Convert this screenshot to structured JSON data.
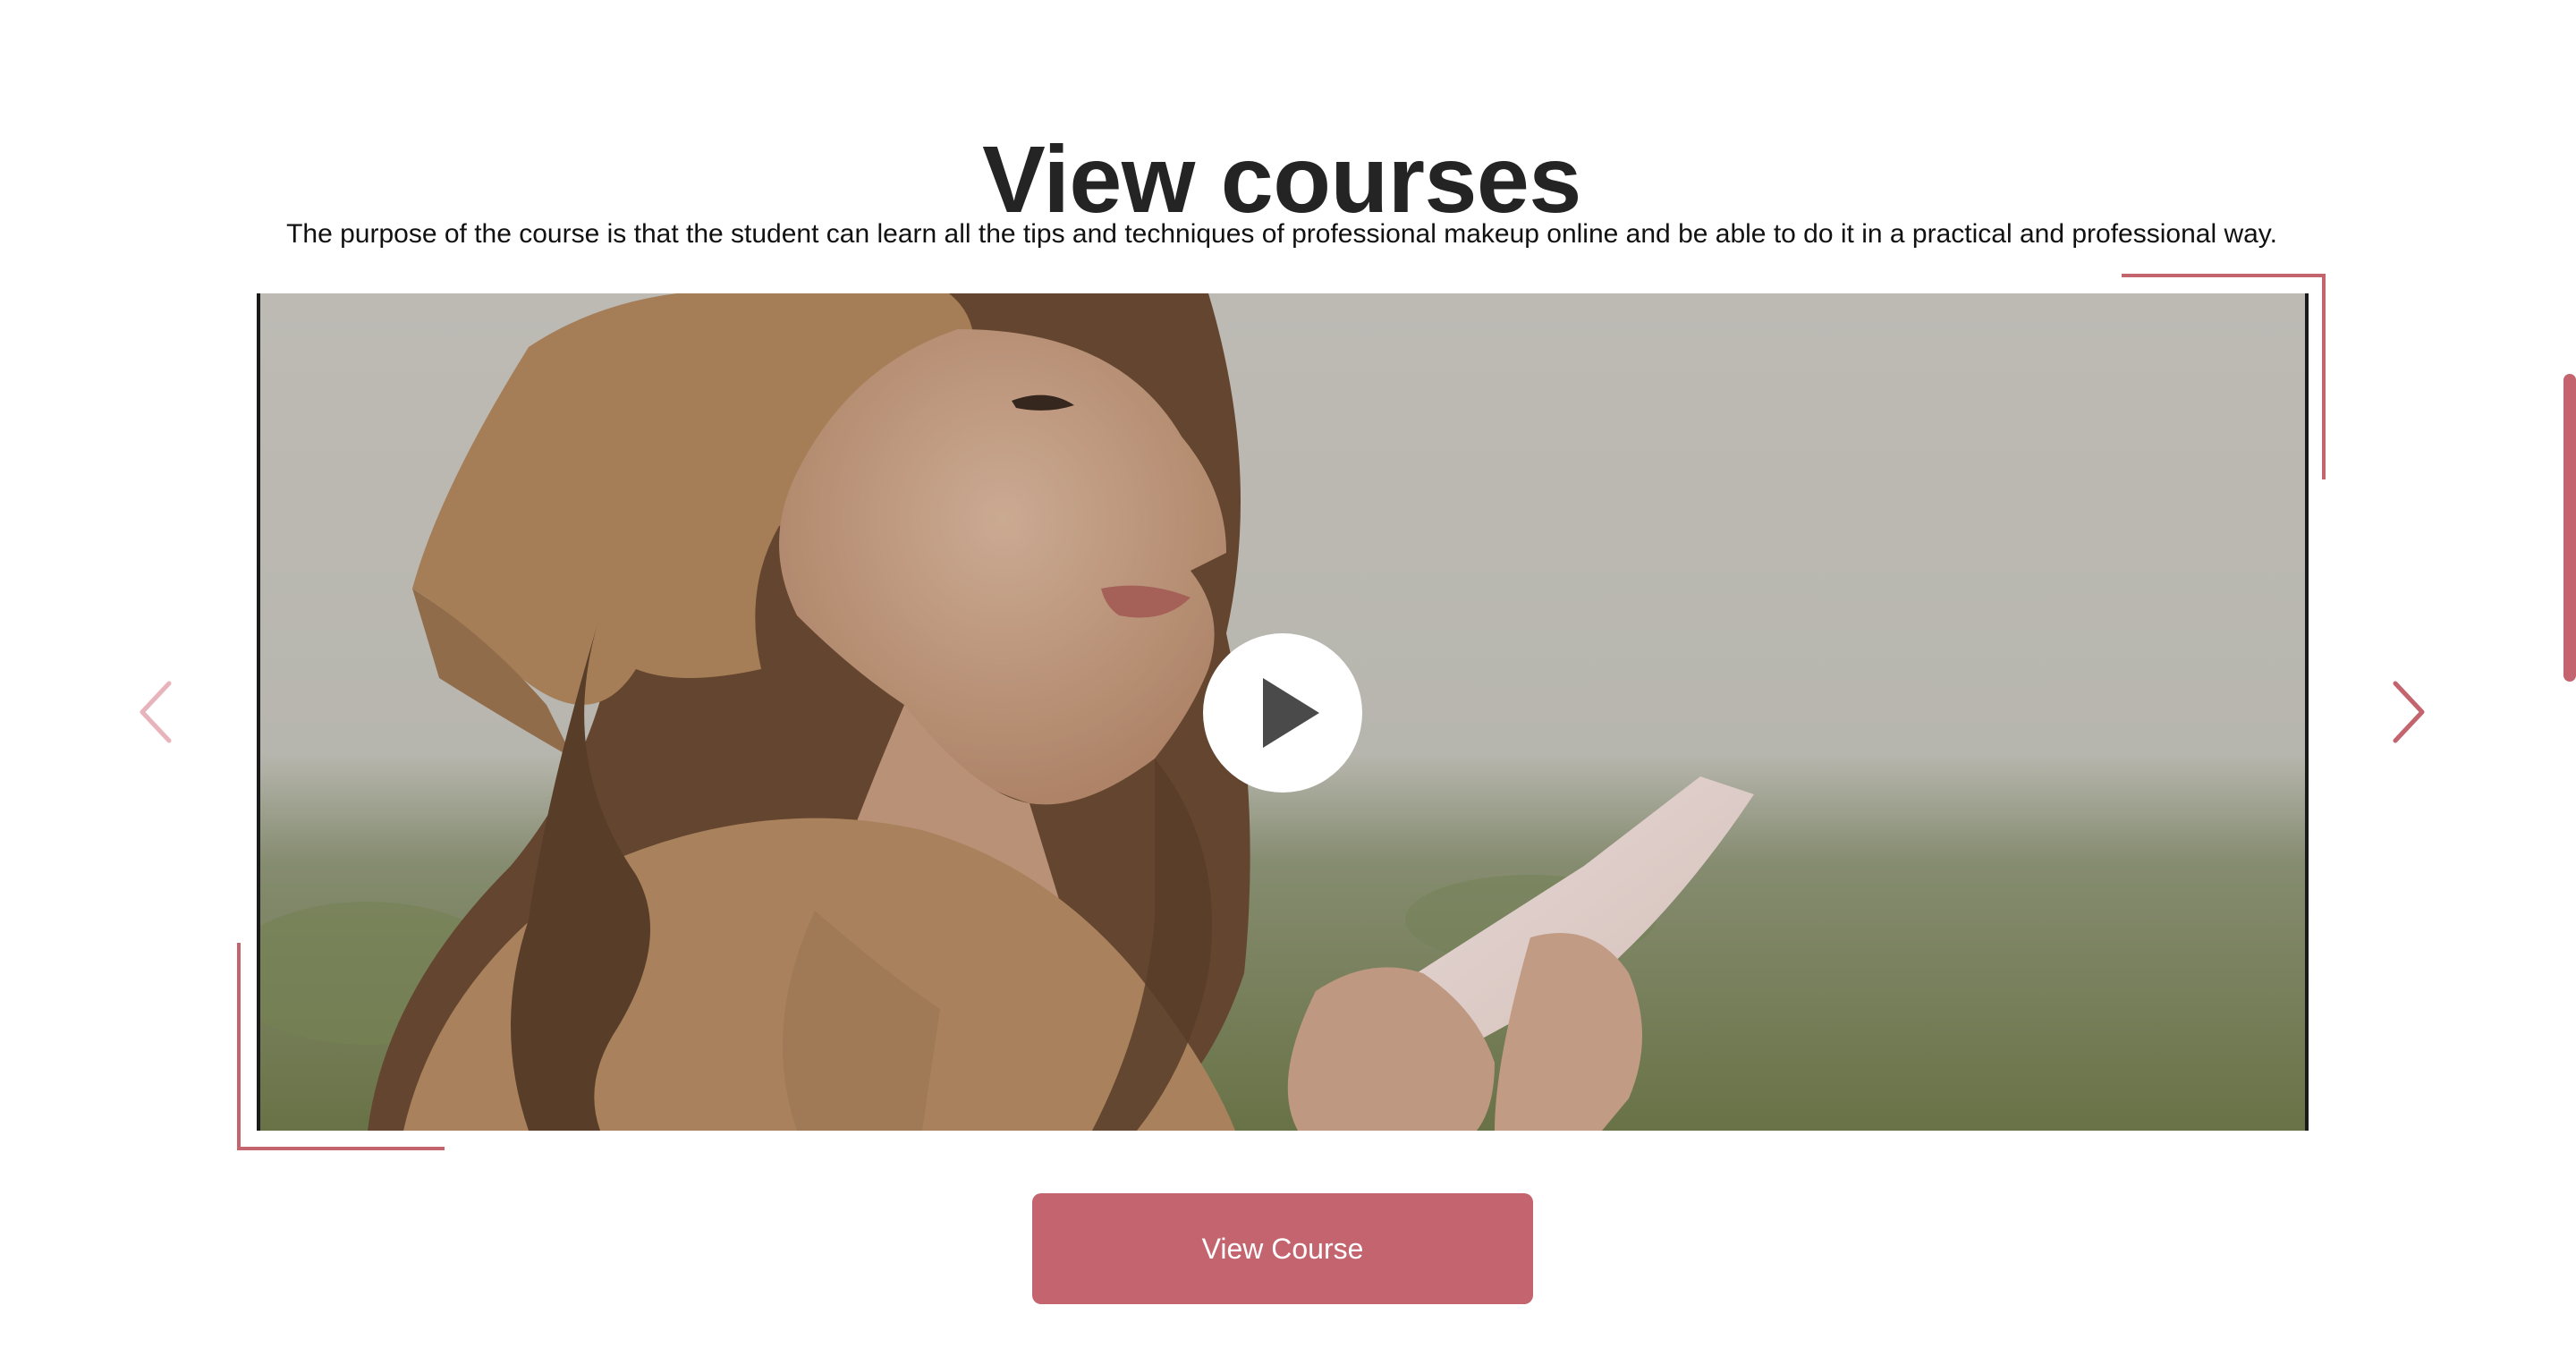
{
  "header": {
    "title": "View courses",
    "description": "The purpose of the course is that the student can learn all the tips and techniques of professional makeup online and be able to do it in a practical and professional way."
  },
  "carousel": {
    "prev_icon": "chevron-left-icon",
    "next_icon": "chevron-right-icon",
    "play_icon": "play-icon",
    "media_description": "Smiling woman in beige headscarf holding a cream tube outdoors"
  },
  "actions": {
    "view_course_label": "View Course"
  },
  "colors": {
    "accent": "#c4646e",
    "accent_light": "#e8b4bc",
    "title": "#242424",
    "text": "#111111",
    "background": "#ffffff"
  }
}
